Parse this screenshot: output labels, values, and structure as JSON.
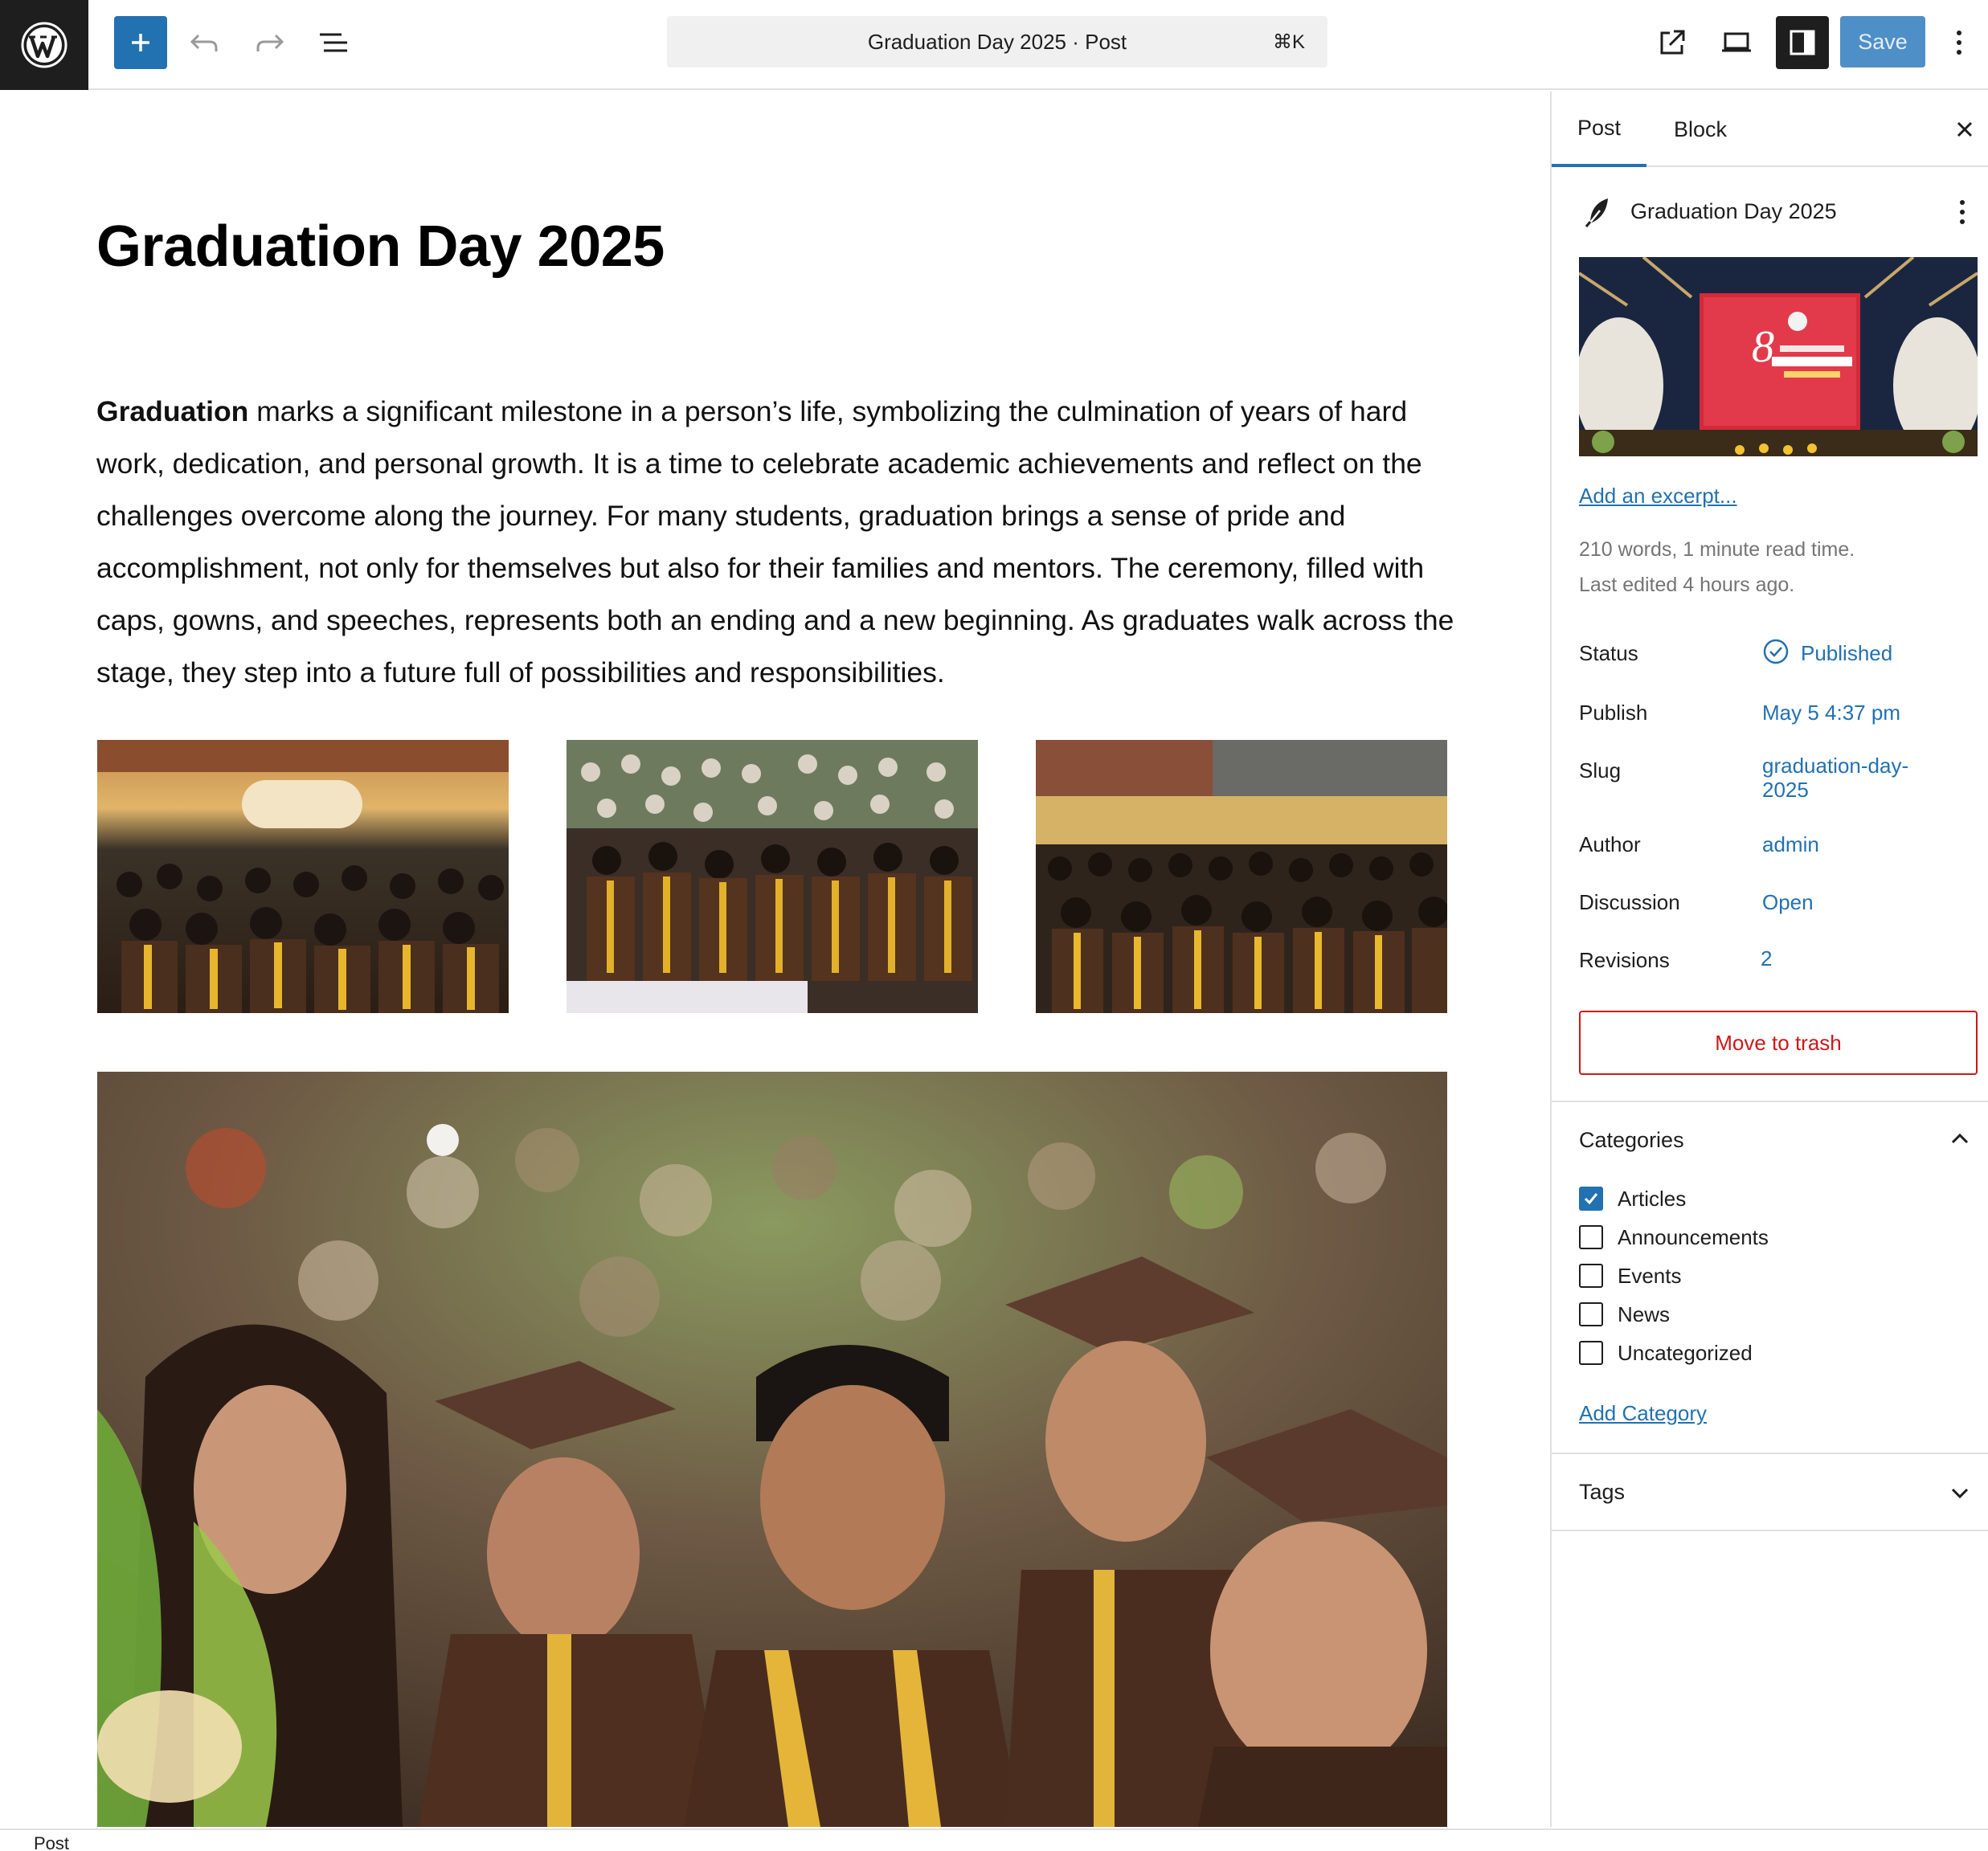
{
  "toolbar": {
    "command_title": "Graduation Day 2025 · Post",
    "command_shortcut": "⌘K",
    "save_label": "Save"
  },
  "editor": {
    "title": "Graduation Day 2025",
    "paragraph_bold": "Graduation",
    "paragraph_rest": " marks a significant milestone in a person’s life, symbolizing the culmination of years of hard work, dedication, and personal growth. It is a time to celebrate academic achievements and reflect on the challenges overcome along the journey. For many students, graduation brings a sense of pride and accomplishment, not only for themselves but also for their families and mentors. The ceremony, filled with caps, gowns, and speeches, represents both an ending and a new beginning. As graduates walk across the stage, they step into a future full of possibilities and responsibilities."
  },
  "sidebar": {
    "tabs": [
      "Post",
      "Block"
    ],
    "summary_title": "Graduation Day 2025",
    "excerpt_link": "Add an excerpt...",
    "word_count": "210 words, 1 minute read time.",
    "last_edited": "Last edited 4 hours ago.",
    "rows": [
      {
        "label": "Status",
        "value": "Published"
      },
      {
        "label": "Publish",
        "value": "May 5 4:37 pm"
      },
      {
        "label": "Slug",
        "value": "graduation-day-\n2025"
      },
      {
        "label": "Author",
        "value": "admin"
      },
      {
        "label": "Discussion",
        "value": "Open"
      },
      {
        "label": "Revisions",
        "value": "2"
      }
    ],
    "trash_label": "Move to trash",
    "categories_title": "Categories",
    "categories": [
      {
        "label": "Articles",
        "checked": true
      },
      {
        "label": "Announcements",
        "checked": false
      },
      {
        "label": "Events",
        "checked": false
      },
      {
        "label": "News",
        "checked": false
      },
      {
        "label": "Uncategorized",
        "checked": false
      }
    ],
    "add_category": "Add Category",
    "tags_title": "Tags"
  },
  "footer": {
    "breadcrumb": "Post"
  },
  "colors": {
    "accent": "#2271b1",
    "danger": "#cc1818",
    "dark": "#1e1e1e"
  },
  "icons": [
    "wordpress-logo-icon",
    "plus-icon",
    "undo-icon",
    "redo-icon",
    "list-view-icon",
    "external-link-icon",
    "desktop-preview-icon",
    "sidebar-toggle-icon",
    "more-vertical-icon",
    "close-icon",
    "feather-icon",
    "check-circle-icon",
    "chevron-up-icon",
    "chevron-down-icon",
    "checkmark-icon"
  ]
}
